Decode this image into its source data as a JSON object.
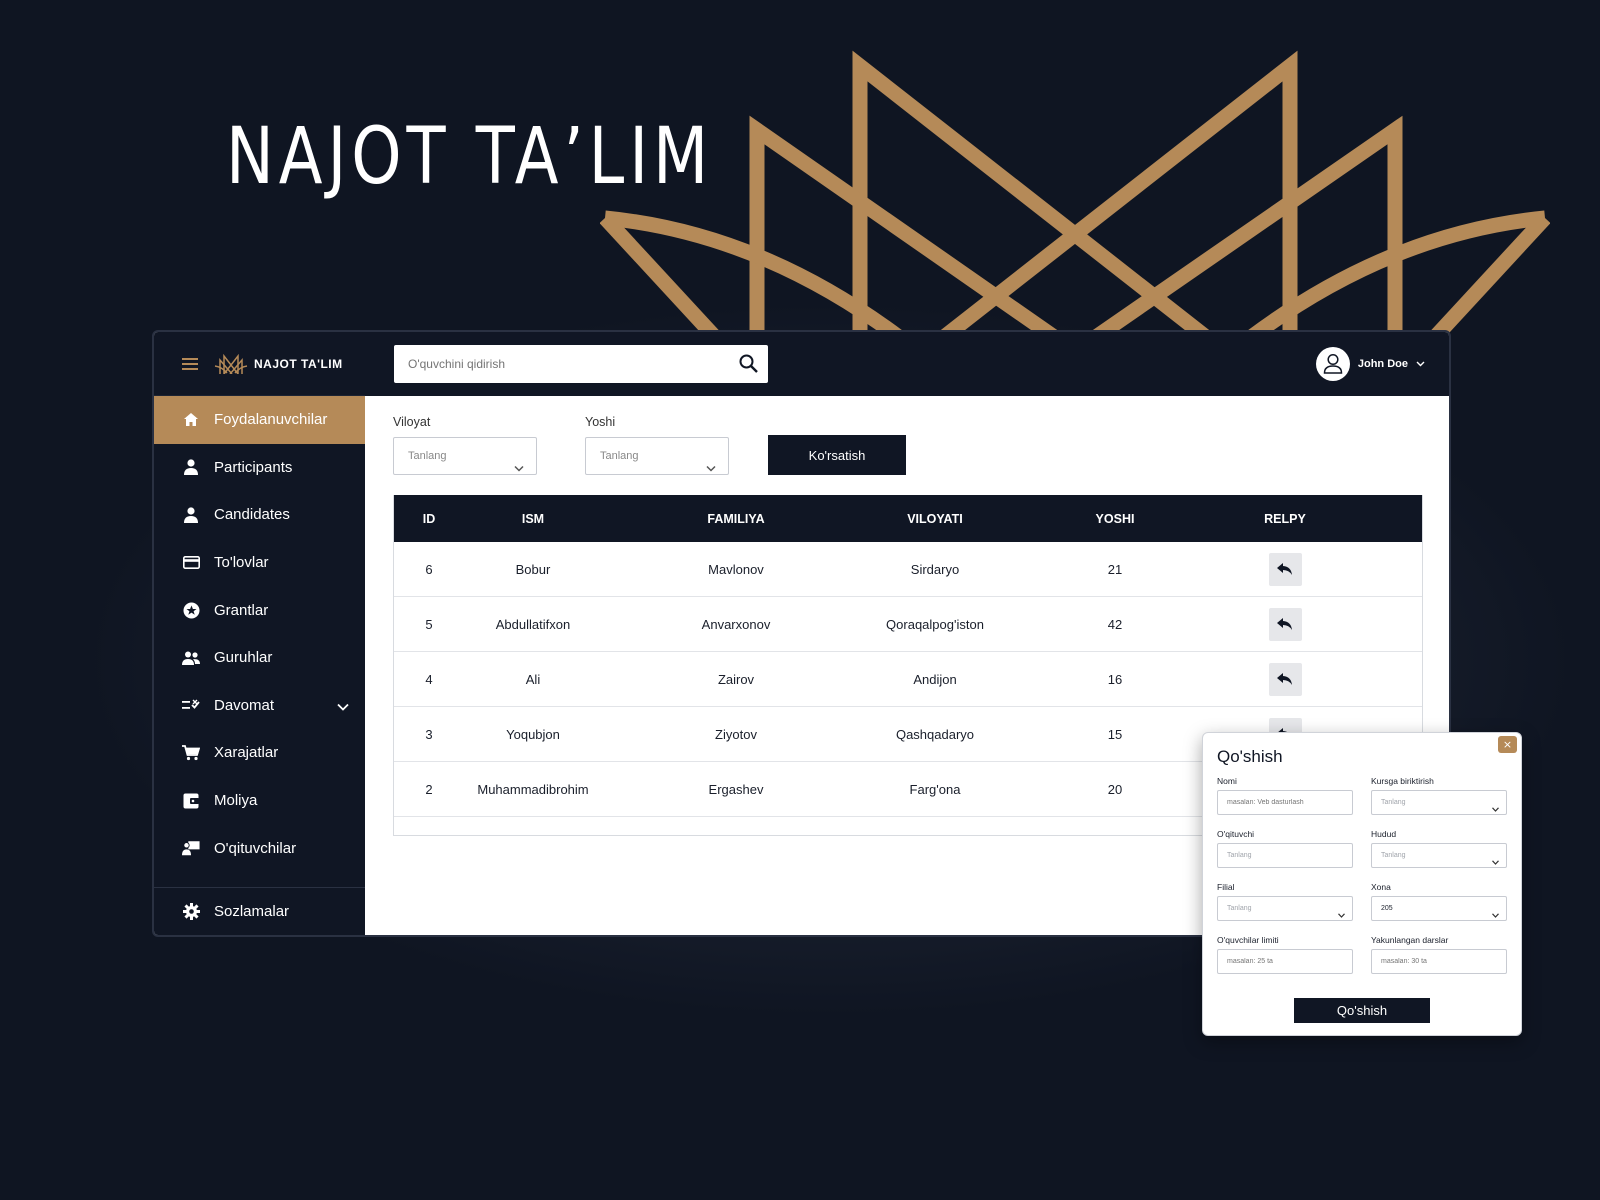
{
  "brand": {
    "hero_title": "NAJOT TA’LIM",
    "mini_title": "NAJOT TA'LIM",
    "accent": "#b58a58",
    "dark": "#101624"
  },
  "search": {
    "placeholder": "O'quvchini qidirish",
    "value": ""
  },
  "user": {
    "name": "John Doe"
  },
  "sidebar": {
    "items": [
      {
        "label": "Foydalanuvchilar",
        "icon": "home-icon",
        "active": true
      },
      {
        "label": "Participants",
        "icon": "person-icon"
      },
      {
        "label": "Candidates",
        "icon": "person-icon"
      },
      {
        "label": "To'lovlar",
        "icon": "credit-card-icon"
      },
      {
        "label": "Grantlar",
        "icon": "star-badge-icon"
      },
      {
        "label": "Guruhlar",
        "icon": "group-icon"
      },
      {
        "label": "Davomat",
        "icon": "checklist-icon",
        "expandable": true
      },
      {
        "label": "Xarajatlar",
        "icon": "cart-icon"
      },
      {
        "label": "Moliya",
        "icon": "wallet-icon"
      },
      {
        "label": "O'qituvchilar",
        "icon": "teacher-icon"
      }
    ],
    "settings": "Sozlamalar"
  },
  "filters": {
    "region_label": "Viloyat",
    "region_value": "Tanlang",
    "age_label": "Yoshi",
    "age_value": "Tanlang",
    "show_button": "Ko'rsatish"
  },
  "table": {
    "headers": {
      "id": "ID",
      "ism": "ISM",
      "familiya": "FAMILIYA",
      "viloyati": "VILOYATI",
      "yoshi": "YOSHI",
      "reply": "RELPY"
    },
    "rows": [
      {
        "id": "6",
        "ism": "Bobur",
        "familiya": "Mavlonov",
        "viloyati": "Sirdaryo",
        "yoshi": "21"
      },
      {
        "id": "5",
        "ism": "Abdullatifxon",
        "familiya": "Anvarxonov",
        "viloyati": "Qoraqalpog'iston",
        "yoshi": "42"
      },
      {
        "id": "4",
        "ism": "Ali",
        "familiya": "Zairov",
        "viloyati": "Andijon",
        "yoshi": "16"
      },
      {
        "id": "3",
        "ism": "Yoqubjon",
        "familiya": "Ziyotov",
        "viloyati": "Qashqadaryo",
        "yoshi": "15"
      },
      {
        "id": "2",
        "ism": "Muhammadibrohim",
        "familiya": "Ergashev",
        "viloyati": "Farg'ona",
        "yoshi": "20"
      }
    ]
  },
  "modal": {
    "title": "Qo'shish",
    "close": "×",
    "fields": {
      "nomi_label": "Nomi",
      "nomi_placeholder": "masalan: Veb dasturlash",
      "kurs_label": "Kursga biriktirish",
      "kurs_value": "Tanlang",
      "oqituvchi_label": "O'qituvchi",
      "oqituvchi_value": "Tanlang",
      "hudud_label": "Hudud",
      "hudud_value": "Tanlang",
      "filial_label": "Filial",
      "filial_value": "Tanlang",
      "xona_label": "Xona",
      "xona_value": "205",
      "limit_label": "O'quvchilar limiti",
      "limit_placeholder": "masalan: 25 ta",
      "darslar_label": "Yakunlangan darslar",
      "darslar_placeholder": "masalan: 30 ta"
    },
    "submit": "Qo'shish"
  }
}
